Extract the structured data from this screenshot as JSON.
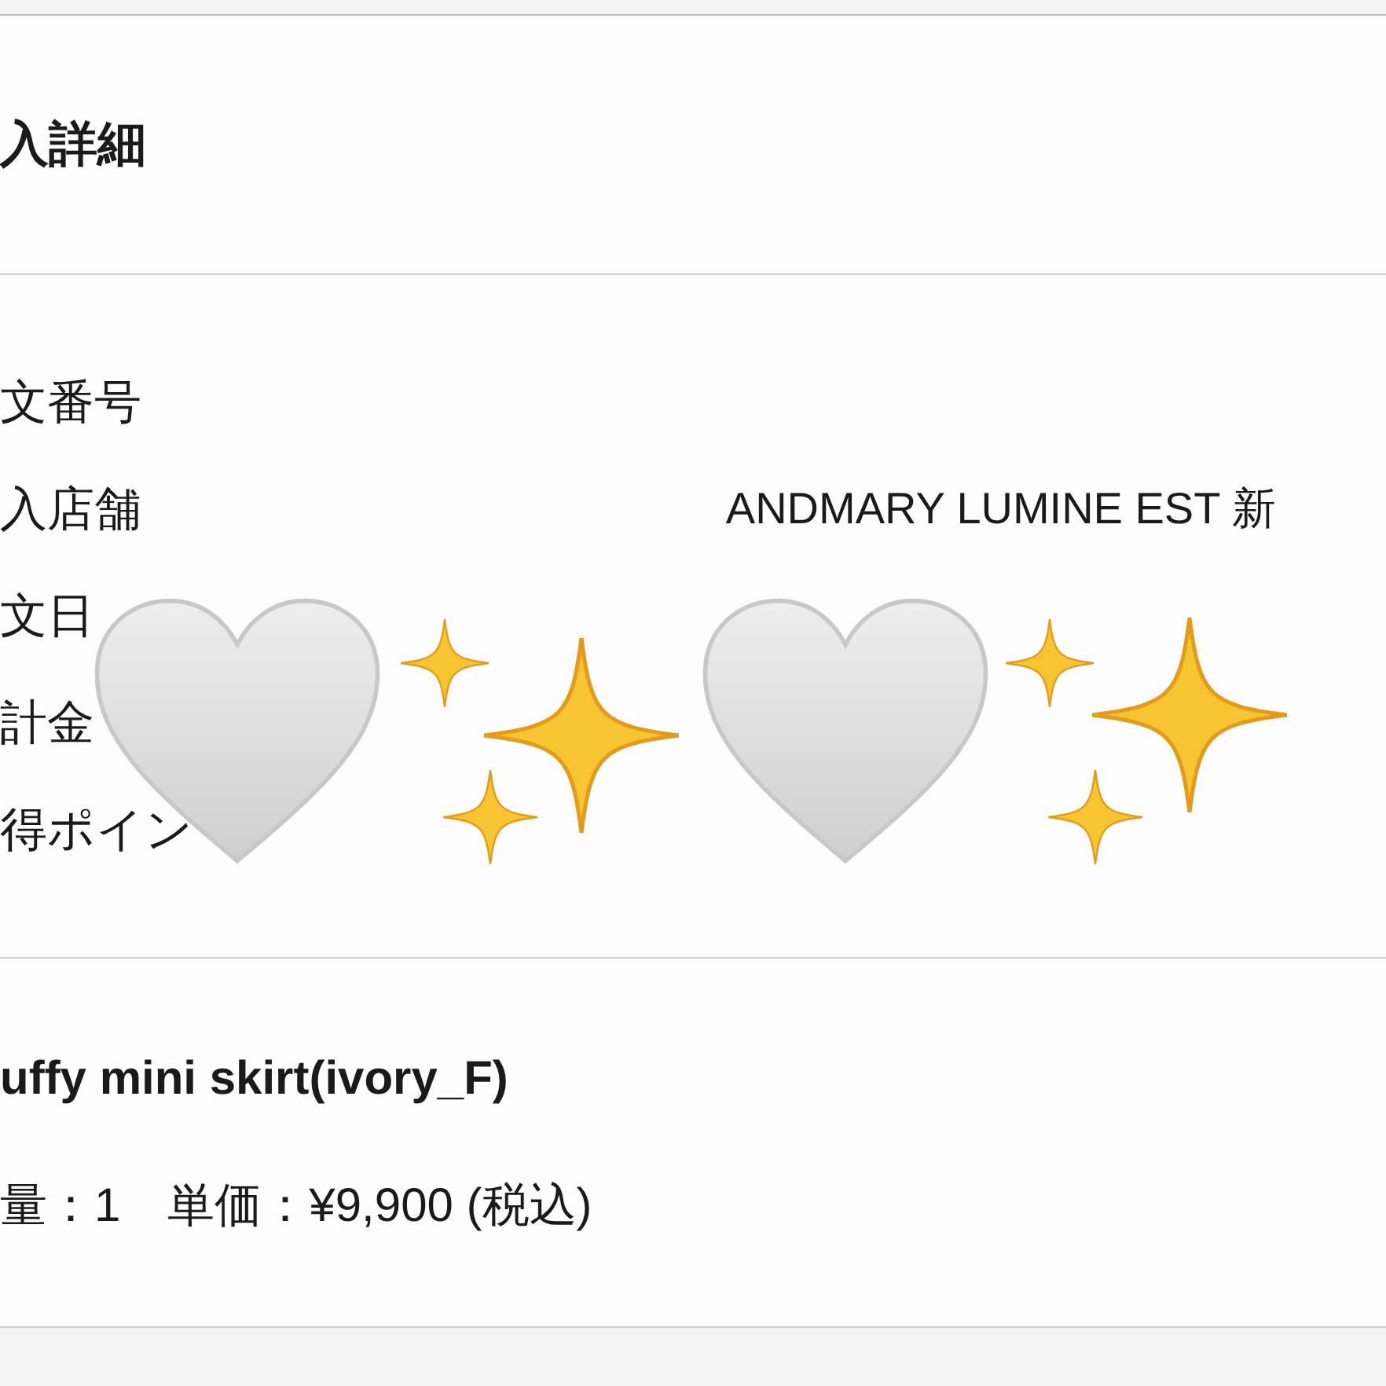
{
  "section_title": "入詳細",
  "details": [
    {
      "label": "文番号"
    },
    {
      "label": "入店舗",
      "value": "ANDMARY LUMINE EST 新"
    },
    {
      "label": "文日"
    },
    {
      "label": "計金"
    },
    {
      "label": "得ポイン"
    }
  ],
  "item": {
    "name": "uffy mini skirt(ivory_F)",
    "quantity_price": "量：1　単価：¥9,900 (税込)"
  }
}
